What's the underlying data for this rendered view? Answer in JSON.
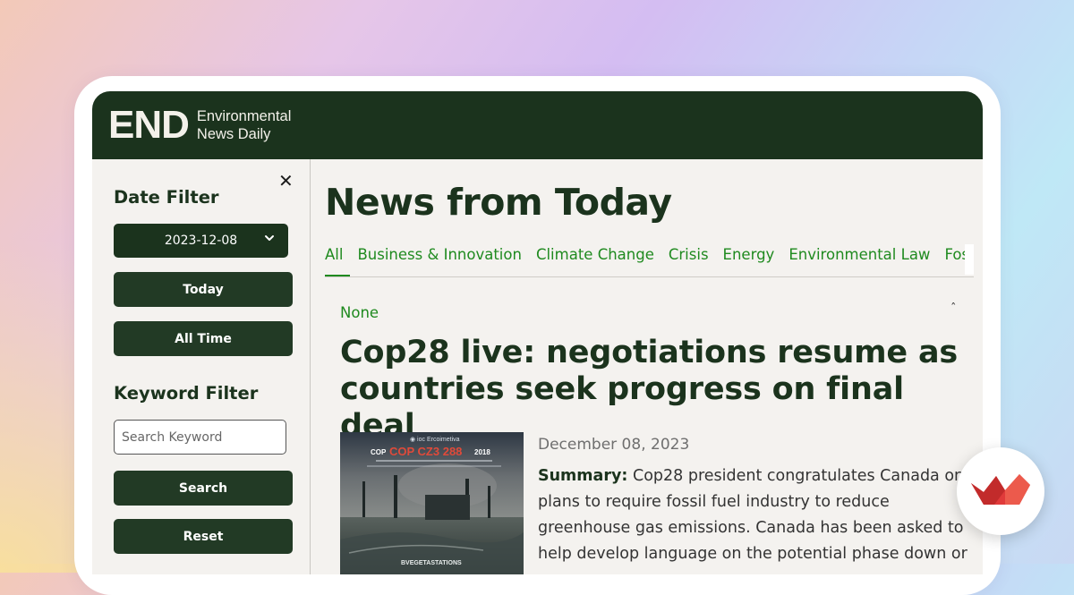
{
  "brand": {
    "mark": "END",
    "name_line1": "Environmental",
    "name_line2": "News Daily",
    "header_color": "#1b331d"
  },
  "sidebar": {
    "close_icon": "close-icon",
    "date_filter_heading": "Date Filter",
    "date_value": "2023-12-08",
    "today_label": "Today",
    "all_time_label": "All Time",
    "keyword_filter_heading": "Keyword Filter",
    "search_placeholder": "Search Keyword",
    "search_label": "Search",
    "reset_label": "Reset"
  },
  "main": {
    "page_title": "News from Today",
    "tabs": [
      {
        "label": "All",
        "active": true
      },
      {
        "label": "Business & Innovation"
      },
      {
        "label": "Climate Change"
      },
      {
        "label": "Crisis"
      },
      {
        "label": "Energy"
      },
      {
        "label": "Environmental Law"
      },
      {
        "label": "Fossil Fuel"
      }
    ],
    "article": {
      "category": "None",
      "collapse_icon": "caret-up-icon",
      "headline": "Cop28 live: negotiations resume as countries seek progress on final deal",
      "date": "December 08, 2023",
      "summary_label": "Summary:",
      "summary_text": "Cop28 president congratulates Canada on plans to require fossil fuel industry to reduce greenhouse gas emissions. Canada has been asked to help develop language on the potential phase down or",
      "thumbnail_text": {
        "top": "COP",
        "big": "COP CZ3 288",
        "year": "2018",
        "bottom": "BVEGETASTATIONS"
      }
    }
  },
  "colors": {
    "accent_green": "#1f8a1f",
    "dark_green": "#1b331d",
    "badge_red": "#e03a3a"
  }
}
